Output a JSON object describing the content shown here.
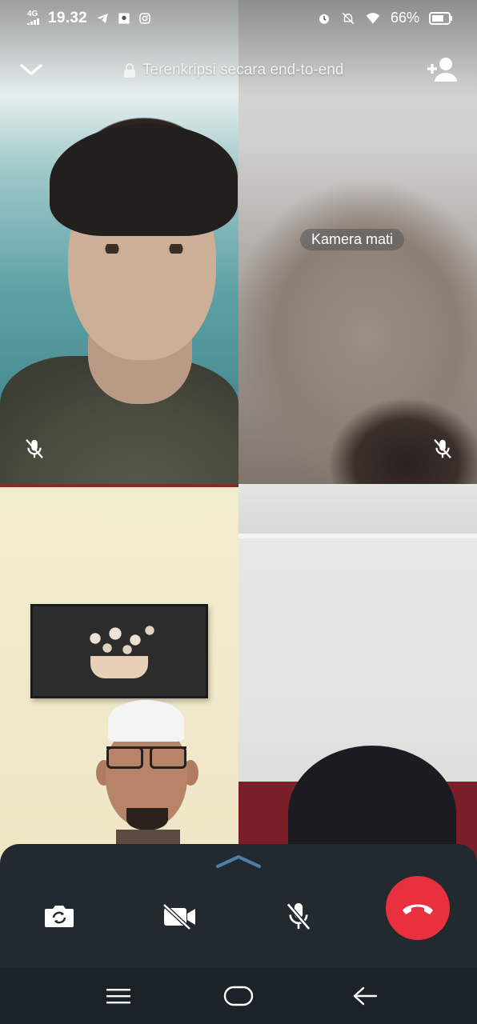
{
  "status_bar": {
    "network": "4G",
    "time": "19.32",
    "battery": "66%",
    "left_icons": [
      "telegram-icon",
      "gallery-icon",
      "instagram-icon"
    ],
    "right_icons": [
      "alarm-icon",
      "bell-off-icon",
      "wifi-icon",
      "battery-icon"
    ]
  },
  "header": {
    "encryption_text": "Terenkripsi secara end-to-end",
    "collapse_icon": "chevron-down-icon",
    "add_participant_icon": "add-person-icon"
  },
  "participants": [
    {
      "position": "top-left",
      "camera": "on",
      "muted": true
    },
    {
      "position": "top-right",
      "camera": "off",
      "camera_off_label": "Kamera mati",
      "muted": true
    },
    {
      "position": "bottom-left",
      "camera": "on"
    },
    {
      "position": "bottom-right",
      "camera": "on"
    }
  ],
  "controls": {
    "expand_icon": "chevron-up-icon",
    "buttons": [
      "switch-camera-icon",
      "video-off-icon",
      "mic-off-icon",
      "end-call-icon"
    ]
  },
  "colors": {
    "end_call": "#e8303f",
    "panel": "#222a2f",
    "nav_bar": "#1c2328"
  },
  "nav_bar": [
    "menu-icon",
    "home-icon",
    "back-icon"
  ]
}
